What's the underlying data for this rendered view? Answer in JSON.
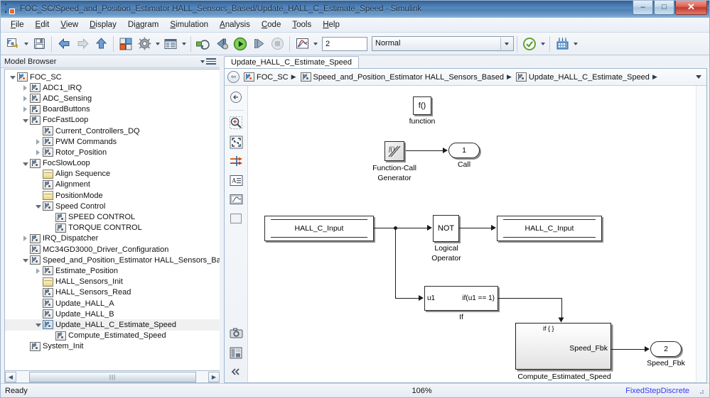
{
  "window": {
    "title": "FOC_SC/Speed_and_Position_Estimator HALL_Sensors_Based/Update_HALL_C_Estimate_Speed - Simulink",
    "minimize_label": "–",
    "maximize_label": "□",
    "close_label": "✕",
    "app_icon": "simulink-model-icon"
  },
  "menu": [
    {
      "label": "File",
      "mnemonic": "F"
    },
    {
      "label": "Edit",
      "mnemonic": "E"
    },
    {
      "label": "View",
      "mnemonic": "V"
    },
    {
      "label": "Display",
      "mnemonic": "D"
    },
    {
      "label": "Diagram",
      "mnemonic": "a"
    },
    {
      "label": "Simulation",
      "mnemonic": "S"
    },
    {
      "label": "Analysis",
      "mnemonic": "A"
    },
    {
      "label": "Code",
      "mnemonic": "C"
    },
    {
      "label": "Tools",
      "mnemonic": "T"
    },
    {
      "label": "Help",
      "mnemonic": "H"
    }
  ],
  "toolbar": {
    "buttons": [
      {
        "name": "new-model-button",
        "icon": "new-model-icon",
        "has_caret": true
      },
      {
        "name": "save-button",
        "icon": "save-icon",
        "has_caret": false
      },
      {
        "name": "back-button",
        "icon": "arrow-left-icon",
        "has_caret": false
      },
      {
        "name": "forward-button",
        "icon": "arrow-right-icon",
        "has_caret": false
      },
      {
        "name": "up-to-parent-button",
        "icon": "arrow-up-icon",
        "has_caret": false
      },
      {
        "name": "library-browser-button",
        "icon": "library-browser-icon",
        "has_caret": false
      },
      {
        "name": "model-configuration-button",
        "icon": "gear-icon",
        "has_caret": true
      },
      {
        "name": "model-explorer-button",
        "icon": "model-explorer-icon",
        "has_caret": true
      },
      {
        "name": "update-model-button",
        "icon": "update-model-icon",
        "has_caret": false
      },
      {
        "name": "step-back-button",
        "icon": "step-back-icon",
        "has_caret": false
      },
      {
        "name": "run-button",
        "icon": "play-icon",
        "has_caret": false
      },
      {
        "name": "step-forward-button",
        "icon": "step-forward-icon",
        "has_caret": false
      },
      {
        "name": "stop-button",
        "icon": "stop-icon",
        "has_caret": false
      },
      {
        "name": "simulation-data-inspector-button",
        "icon": "scope-icon",
        "has_caret": true
      }
    ],
    "stop_time_value": "2",
    "sim_mode_value": "Normal",
    "check_button_name": "model-advisor-check-icon",
    "build_button_name": "build-model-icon",
    "accent_play_color": "#4aa832",
    "accent_orange": "#e8672a"
  },
  "model_browser": {
    "header": "Model Browser",
    "tree": [
      {
        "label": "FOC_SC",
        "depth": 0,
        "twisty": "open",
        "icon": "model-root-icon",
        "selected": false
      },
      {
        "label": "ADC1_IRQ",
        "depth": 1,
        "twisty": "closed",
        "icon": "subsystem-icon",
        "selected": false
      },
      {
        "label": "ADC_Sensing",
        "depth": 1,
        "twisty": "closed",
        "icon": "subsystem-icon",
        "selected": false
      },
      {
        "label": "BoardButtons",
        "depth": 1,
        "twisty": "closed",
        "icon": "subsystem-icon",
        "selected": false
      },
      {
        "label": "FocFastLoop",
        "depth": 1,
        "twisty": "open",
        "icon": "subsystem-icon",
        "selected": false
      },
      {
        "label": "Current_Controllers_DQ",
        "depth": 2,
        "twisty": "none",
        "icon": "subsystem-icon",
        "selected": false
      },
      {
        "label": "PWM Commands",
        "depth": 2,
        "twisty": "closed",
        "icon": "subsystem-icon",
        "selected": false
      },
      {
        "label": "Rotor_Position",
        "depth": 2,
        "twisty": "closed",
        "icon": "subsystem-icon",
        "selected": false
      },
      {
        "label": "FocSlowLoop",
        "depth": 1,
        "twisty": "open",
        "icon": "subsystem-icon",
        "selected": false
      },
      {
        "label": "Align Sequence",
        "depth": 2,
        "twisty": "none",
        "icon": "chart-icon",
        "selected": false
      },
      {
        "label": "Alignment",
        "depth": 2,
        "twisty": "none",
        "icon": "subsystem-icon",
        "selected": false
      },
      {
        "label": "PositionMode",
        "depth": 2,
        "twisty": "none",
        "icon": "chart-icon",
        "selected": false
      },
      {
        "label": "Speed Control",
        "depth": 2,
        "twisty": "open",
        "icon": "subsystem-icon",
        "selected": false
      },
      {
        "label": "SPEED CONTROL",
        "depth": 3,
        "twisty": "none",
        "icon": "subsystem-icon",
        "selected": false
      },
      {
        "label": "TORQUE CONTROL",
        "depth": 3,
        "twisty": "none",
        "icon": "subsystem-icon",
        "selected": false
      },
      {
        "label": "IRQ_Dispatcher",
        "depth": 1,
        "twisty": "closed",
        "icon": "subsystem-icon",
        "selected": false
      },
      {
        "label": "MC34GD3000_Driver_Configuration",
        "depth": 1,
        "twisty": "none",
        "icon": "subsystem-icon",
        "selected": false
      },
      {
        "label": "Speed_and_Position_Estimator HALL_Sensors_Based",
        "depth": 1,
        "twisty": "open",
        "icon": "subsystem-icon",
        "selected": false
      },
      {
        "label": "Estimate_Position",
        "depth": 2,
        "twisty": "closed",
        "icon": "subsystem-icon",
        "selected": false
      },
      {
        "label": "HALL_Sensors_Init",
        "depth": 2,
        "twisty": "none",
        "icon": "chart-icon",
        "selected": false
      },
      {
        "label": "HALL_Sensors_Read",
        "depth": 2,
        "twisty": "none",
        "icon": "subsystem-icon",
        "selected": false
      },
      {
        "label": "Update_HALL_A",
        "depth": 2,
        "twisty": "none",
        "icon": "subsystem-icon",
        "selected": false
      },
      {
        "label": "Update_HALL_B",
        "depth": 2,
        "twisty": "none",
        "icon": "subsystem-icon",
        "selected": false
      },
      {
        "label": "Update_HALL_C_Estimate_Speed",
        "depth": 2,
        "twisty": "open",
        "icon": "subsystem-current-icon",
        "selected": true
      },
      {
        "label": "Compute_Estimated_Speed",
        "depth": 3,
        "twisty": "none",
        "icon": "subsystem-icon",
        "selected": false
      },
      {
        "label": "System_Init",
        "depth": 1,
        "twisty": "none",
        "icon": "subsystem-icon",
        "selected": false
      }
    ]
  },
  "editor": {
    "tab_label": "Update_HALL_C_Estimate_Speed",
    "breadcrumb": [
      {
        "label": "FOC_SC",
        "icon": "model-root-icon"
      },
      {
        "label": "Speed_and_Position_Estimator HALL_Sensors_Based",
        "icon": "subsystem-icon"
      },
      {
        "label": "Update_HALL_C_Estimate_Speed",
        "icon": "subsystem-icon"
      }
    ],
    "breadcrumb_separator": "▶",
    "back_icon": "back-circle-icon",
    "overflow_icon": "chevron-down-icon",
    "vtools": [
      {
        "name": "explore-up-icon"
      },
      {
        "name": "zoom-in-icon"
      },
      {
        "name": "fit-to-view-icon"
      },
      {
        "name": "signal-highlight-icon"
      },
      {
        "name": "annotation-icon"
      },
      {
        "name": "scope-viewer-icon"
      },
      {
        "name": "blank-block-icon"
      },
      {
        "name": "snapshot-icon"
      },
      {
        "name": "layout-icon"
      },
      {
        "name": "collapse-panel-icon"
      }
    ]
  },
  "diagram": {
    "blocks": [
      {
        "name": "function-trigger-block",
        "type": "function-caller",
        "text": "f()",
        "caption": "function"
      },
      {
        "name": "function-call-generator-block",
        "type": "function-call-generator",
        "text": "",
        "caption": "Function-Call\nGenerator"
      },
      {
        "name": "call-outport-block",
        "type": "outport",
        "text": "1",
        "caption": "Call"
      },
      {
        "name": "hall-c-input-read-block",
        "type": "data-store-read",
        "text": "HALL_C_Input",
        "caption": ""
      },
      {
        "name": "logical-operator-not-block",
        "type": "logical-operator",
        "text": "NOT",
        "caption": "Logical\nOperator"
      },
      {
        "name": "hall-c-input-write-block",
        "type": "data-store-write",
        "text": "HALL_C_Input",
        "caption": ""
      },
      {
        "name": "if-block",
        "type": "if",
        "text_in": "u1",
        "text_out": "if(u1 == 1)",
        "caption": "If"
      },
      {
        "name": "compute-estimated-speed-subsystem",
        "type": "subsystem",
        "text_in": "if { }",
        "text_out": "Speed_Fbk",
        "caption": "Compute_Estimated_Speed"
      },
      {
        "name": "speed-fbk-outport-block",
        "type": "outport",
        "text": "2",
        "caption": "Speed_Fbk"
      }
    ],
    "caption_function": "function",
    "caption_fcg_l1": "Function-Call",
    "caption_fcg_l2": "Generator",
    "caption_call": "Call",
    "caption_logical_l1": "Logical",
    "caption_logical_l2": "Operator",
    "caption_if": "If",
    "caption_subsystem": "Compute_Estimated_Speed",
    "caption_speed_fbk": "Speed_Fbk",
    "text_function": "f()",
    "text_not": "NOT",
    "text_hall_read": "HALL_C_Input",
    "text_hall_write": "HALL_C_Input",
    "text_if_in": "u1",
    "text_if_cond": "if(u1 == 1)",
    "text_sub_trigger": "if { }",
    "text_sub_out": "Speed_Fbk",
    "text_out_call": "1",
    "text_out_speed": "2"
  },
  "statusbar": {
    "status": "Ready",
    "zoom": "106%",
    "solver": "FixedStepDiscrete",
    "solver_color": "#3a3af0"
  },
  "hscrollbar": {
    "left_arrow": "◀",
    "right_arrow": "▶",
    "thumb_grip": "|||"
  }
}
